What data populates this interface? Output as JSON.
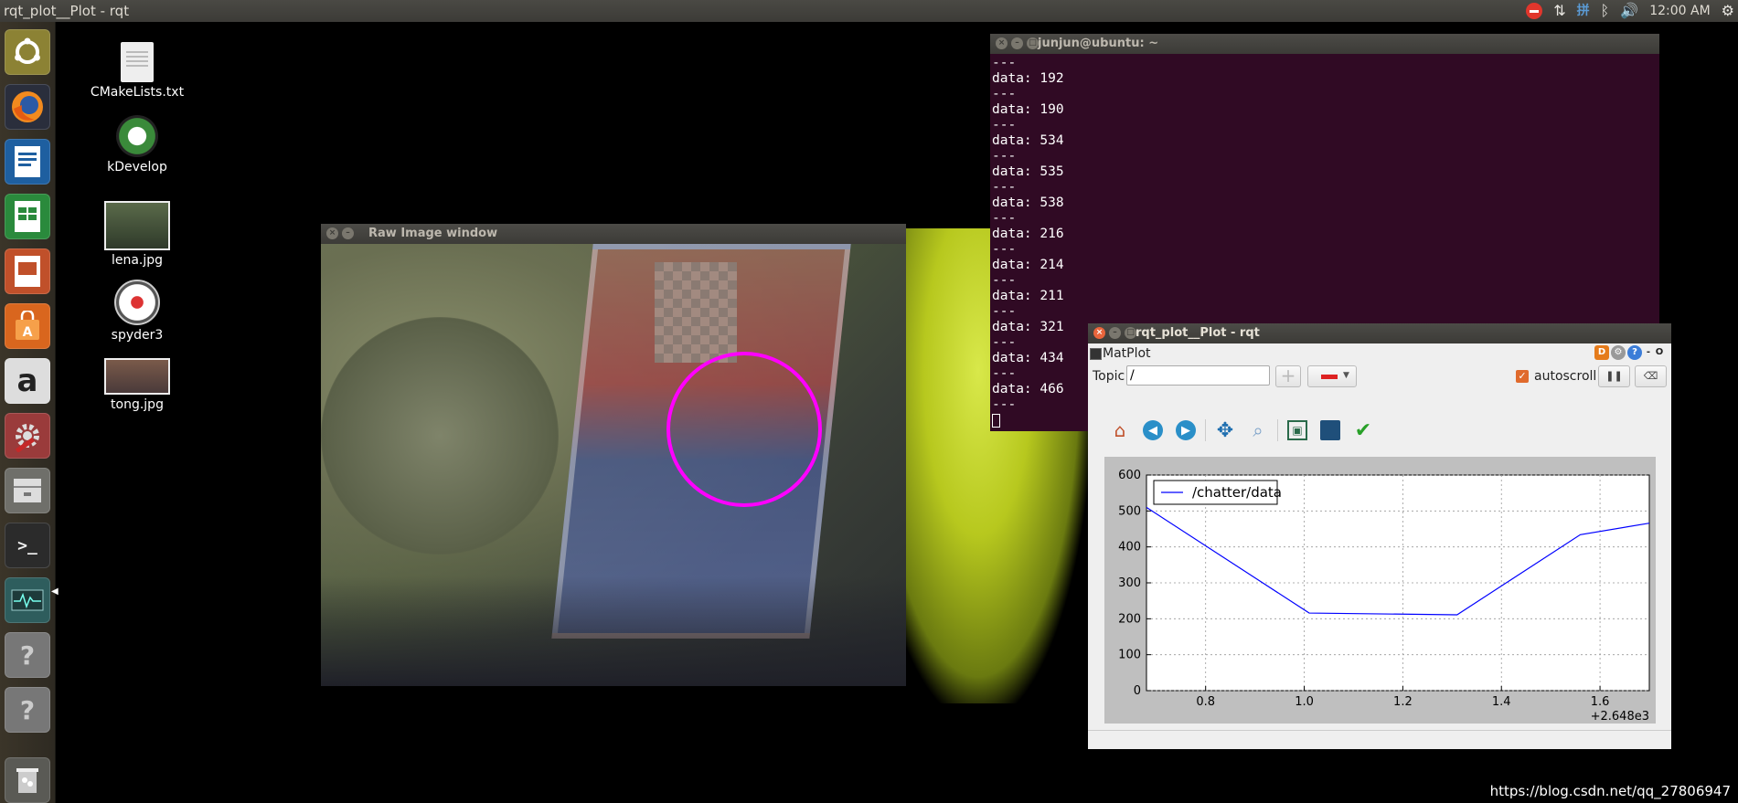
{
  "panel": {
    "title": "rqt_plot__Plot - rqt",
    "clock": "12:00 AM",
    "network_label": "拼"
  },
  "launcher": {
    "items": [
      {
        "name": "ubuntu-dash",
        "icon": "ubuntu-logo-icon"
      },
      {
        "name": "firefox",
        "icon": "firefox-icon"
      },
      {
        "name": "libreoffice-writer",
        "icon": "writer-icon"
      },
      {
        "name": "libreoffice-calc",
        "icon": "calc-icon"
      },
      {
        "name": "libreoffice-impress",
        "icon": "impress-icon"
      },
      {
        "name": "software-center",
        "icon": "shopping-bag-icon"
      },
      {
        "name": "amazon",
        "icon": "amazon-icon",
        "glyph": "a"
      },
      {
        "name": "system-settings",
        "icon": "settings-icon"
      },
      {
        "name": "files",
        "icon": "file-cabinet-icon"
      },
      {
        "name": "terminal",
        "icon": "terminal-icon",
        "glyph": ">_"
      },
      {
        "name": "system-monitor",
        "icon": "monitor-icon"
      },
      {
        "name": "unknown-app-1",
        "icon": "question-icon",
        "glyph": "?"
      },
      {
        "name": "unknown-app-2",
        "icon": "question-icon",
        "glyph": "?"
      },
      {
        "name": "trash",
        "icon": "trash-icon"
      }
    ]
  },
  "desktop": {
    "icons": [
      {
        "label": "CMakeLists.txt",
        "icon": "text-file-icon"
      },
      {
        "label": "kDevelop",
        "icon": "kdevelop-icon"
      },
      {
        "label": "lena.jpg",
        "icon": "image-file-icon"
      },
      {
        "label": "spyder3",
        "icon": "spyder-icon"
      },
      {
        "label": "tong.jpg",
        "icon": "image-file-icon"
      }
    ]
  },
  "raw_window": {
    "title": "Raw Image window"
  },
  "terminal": {
    "title": "junjun@ubuntu: ~",
    "lines": [
      "---",
      "data: 192",
      "---",
      "data: 190",
      "---",
      "data: 534",
      "---",
      "data: 535",
      "---",
      "data: 538",
      "---",
      "data: 216",
      "---",
      "data: 214",
      "---",
      "data: 211",
      "---",
      "data: 321",
      "---",
      "data: 434",
      "---",
      "data: 466",
      "---"
    ]
  },
  "plot_window": {
    "title": "rqt_plot__Plot - rqt",
    "plugin_name": "MatPlot",
    "topic_label": "Topic",
    "topic_value": "/",
    "autoscroll_label": "autoscroll",
    "autoscroll_checked": true,
    "header_icons": {
      "d": "D",
      "gear": "⚙",
      "help": "?",
      "minus": "-",
      "float": "O"
    }
  },
  "chart_data": {
    "type": "line",
    "series": [
      {
        "name": "/chatter/data",
        "color": "#0000ff",
        "x": [
          2648.68,
          2649.01,
          2649.31,
          2649.56,
          2649.7
        ],
        "y": [
          510,
          216,
          211,
          434,
          466
        ]
      }
    ],
    "xlim": [
      2648.68,
      2649.7
    ],
    "ylim": [
      0,
      600
    ],
    "xticks": [
      2648.8,
      2649.0,
      2649.2,
      2649.4,
      2649.6
    ],
    "xtick_labels": [
      "0.8",
      "1.0",
      "1.2",
      "1.4",
      "1.6"
    ],
    "x_offset_label": "+2.648e3",
    "yticks": [
      0,
      100,
      200,
      300,
      400,
      500,
      600
    ],
    "ytick_labels": [
      "0",
      "100",
      "200",
      "300",
      "400",
      "500",
      "600"
    ],
    "grid": true,
    "legend_position": "top-left"
  },
  "watermark": "https://blog.csdn.net/qq_27806947"
}
